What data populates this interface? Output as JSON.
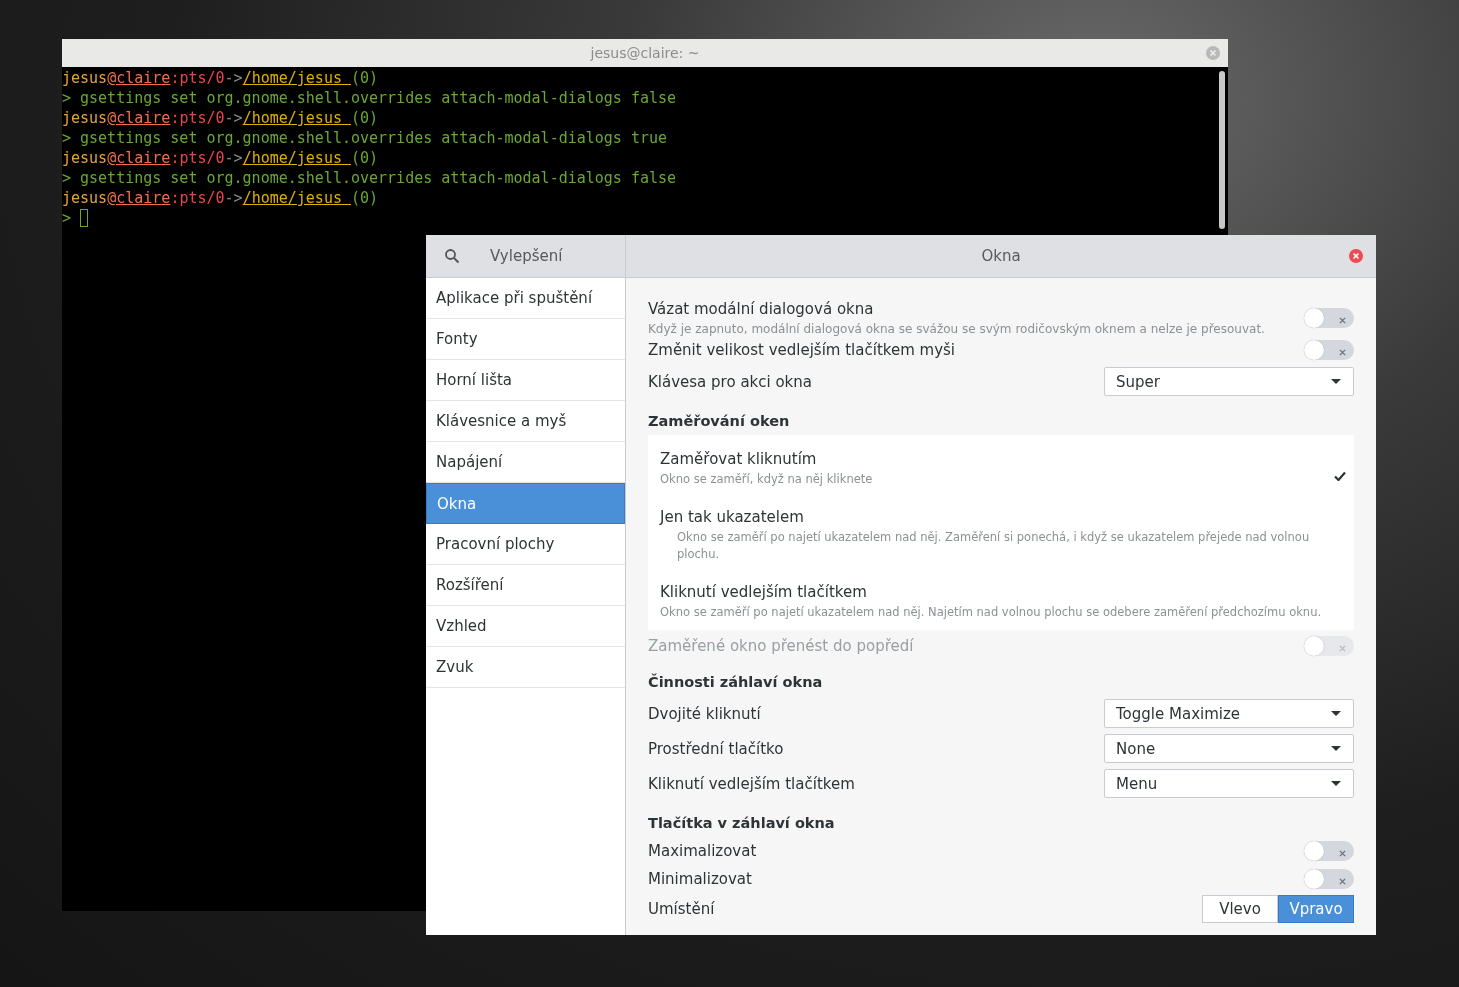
{
  "terminal": {
    "title": "jesus@claire: ~",
    "lines": [
      {
        "kind": "prompt",
        "segments": [
          {
            "text": "jesus",
            "color": "#e8a33c",
            "underline": false
          },
          {
            "text": "@claire",
            "color": "#f0704a",
            "underline": true
          },
          {
            "text": ":pts/0",
            "color": "#e8454a",
            "underline": false
          },
          {
            "text": "->",
            "color": "#8a8a8a",
            "underline": false
          },
          {
            "text": "/home/jesus ",
            "color": "#e0b000",
            "underline": true
          },
          {
            "text": "(0)",
            "color": "#6aa832",
            "underline": false
          }
        ]
      },
      {
        "kind": "command",
        "prompt": ">",
        "text": "gsettings set org.gnome.shell.overrides attach-modal-dialogs false"
      },
      {
        "kind": "prompt",
        "segments": [
          {
            "text": "jesus",
            "color": "#e8a33c",
            "underline": false
          },
          {
            "text": "@claire",
            "color": "#f0704a",
            "underline": true
          },
          {
            "text": ":pts/0",
            "color": "#e8454a",
            "underline": false
          },
          {
            "text": "->",
            "color": "#8a8a8a",
            "underline": false
          },
          {
            "text": "/home/jesus ",
            "color": "#e0b000",
            "underline": true
          },
          {
            "text": "(0)",
            "color": "#6aa832",
            "underline": false
          }
        ]
      },
      {
        "kind": "command",
        "prompt": ">",
        "text": "gsettings set org.gnome.shell.overrides attach-modal-dialogs true"
      },
      {
        "kind": "prompt",
        "segments": [
          {
            "text": "jesus",
            "color": "#e8a33c",
            "underline": false
          },
          {
            "text": "@claire",
            "color": "#f0704a",
            "underline": true
          },
          {
            "text": ":pts/0",
            "color": "#e8454a",
            "underline": false
          },
          {
            "text": "->",
            "color": "#8a8a8a",
            "underline": false
          },
          {
            "text": "/home/jesus ",
            "color": "#e0b000",
            "underline": true
          },
          {
            "text": "(0)",
            "color": "#6aa832",
            "underline": false
          }
        ]
      },
      {
        "kind": "command",
        "prompt": ">",
        "text": "gsettings set org.gnome.shell.overrides attach-modal-dialogs false"
      },
      {
        "kind": "prompt",
        "segments": [
          {
            "text": "jesus",
            "color": "#e8a33c",
            "underline": false
          },
          {
            "text": "@claire",
            "color": "#f0704a",
            "underline": true
          },
          {
            "text": ":pts/0",
            "color": "#e8454a",
            "underline": false
          },
          {
            "text": "->",
            "color": "#8a8a8a",
            "underline": false
          },
          {
            "text": "/home/jesus ",
            "color": "#e0b000",
            "underline": true
          },
          {
            "text": "(0)",
            "color": "#6aa832",
            "underline": false
          }
        ]
      },
      {
        "kind": "input",
        "prompt": ">"
      }
    ]
  },
  "settings": {
    "app_title": "Vylepšení",
    "page_title": "Okna",
    "sidebar": {
      "items": [
        {
          "label": "Aplikace při spuštění",
          "selected": false
        },
        {
          "label": "Fonty",
          "selected": false
        },
        {
          "label": "Horní lišta",
          "selected": false
        },
        {
          "label": "Klávesnice a myš",
          "selected": false
        },
        {
          "label": "Napájení",
          "selected": false
        },
        {
          "label": "Okna",
          "selected": true
        },
        {
          "label": "Pracovní plochy",
          "selected": false
        },
        {
          "label": "Rozšíření",
          "selected": false
        },
        {
          "label": "Vzhled",
          "selected": false
        },
        {
          "label": "Zvuk",
          "selected": false
        }
      ]
    },
    "rows": [
      {
        "kind": "switch",
        "label": "Vázat modální dialogová okna",
        "description": "Když je zapnuto, modální dialogová okna se svážou se svým rodičovským oknem a nelze je přesouvat.",
        "on": false,
        "disabled": false
      },
      {
        "kind": "switch",
        "label": "Změnit velikost vedlejším tlačítkem myši",
        "on": false,
        "disabled": false
      },
      {
        "kind": "dropdown",
        "label": "Klávesa pro akci okna",
        "value": "Super"
      },
      {
        "kind": "heading",
        "label": "Zaměřování oken"
      },
      {
        "kind": "choices",
        "options": [
          {
            "title": "Zaměřovat kliknutím",
            "description": "Okno se zaměří, když na něj kliknete",
            "selected": true
          },
          {
            "title": "Jen tak ukazatelem",
            "description": "Okno se zaměří po najetí ukazatelem nad něj. Zaměření si ponechá, i když se ukazatelem přejede nad volnou plochu.",
            "selected": false
          },
          {
            "title": "Kliknutí vedlejším tlačítkem",
            "description": "Okno se zaměří po najetí ukazatelem nad něj. Najetím nad volnou plochu se odebere zaměření předchozímu oknu.",
            "selected": false
          }
        ]
      },
      {
        "kind": "switch",
        "label": "Zaměřené okno přenést do popředí",
        "on": false,
        "disabled": true
      },
      {
        "kind": "heading",
        "label": "Činnosti záhlaví okna"
      },
      {
        "kind": "dropdown",
        "label": "Dvojité kliknutí",
        "value": "Toggle Maximize"
      },
      {
        "kind": "dropdown",
        "label": "Prostřední tlačítko",
        "value": "None"
      },
      {
        "kind": "dropdown",
        "label": "Kliknutí vedlejším tlačítkem",
        "value": "Menu"
      },
      {
        "kind": "heading",
        "label": "Tlačítka v záhlaví okna"
      },
      {
        "kind": "switch",
        "label": "Maximalizovat",
        "on": false,
        "disabled": false
      },
      {
        "kind": "switch",
        "label": "Minimalizovat",
        "on": false,
        "disabled": false
      },
      {
        "kind": "segmented",
        "label": "Umístění",
        "options": [
          {
            "label": "Vlevo",
            "selected": false
          },
          {
            "label": "Vpravo",
            "selected": true
          }
        ]
      }
    ]
  }
}
